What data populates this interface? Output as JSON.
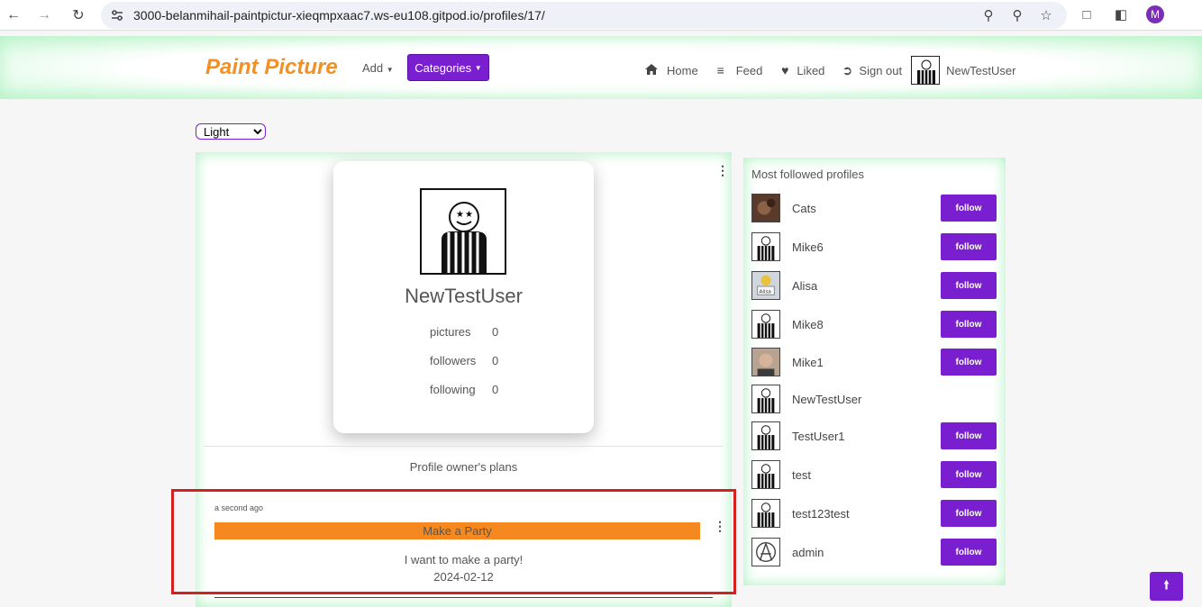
{
  "browser": {
    "url": "3000-belanmihail-paintpictur-xieqmpxaac7.ws-eu108.gitpod.io/profiles/17/",
    "profile_initial": "M"
  },
  "header": {
    "brand": "Paint Picture",
    "add_label": "Add",
    "categories_label": "Categories",
    "nav": [
      {
        "label": "Home",
        "icon": "home-icon"
      },
      {
        "label": "Feed",
        "icon": "list-icon"
      },
      {
        "label": "Liked",
        "icon": "heart-icon"
      },
      {
        "label": "Sign out",
        "icon": "sign-out-icon"
      }
    ],
    "username": "NewTestUser"
  },
  "theme": {
    "selected": "Light"
  },
  "profile": {
    "name": "NewTestUser",
    "stats": [
      {
        "label": "pictures",
        "value": "0"
      },
      {
        "label": "followers",
        "value": "0"
      },
      {
        "label": "following",
        "value": "0"
      }
    ],
    "plans_title": "Profile owner's plans"
  },
  "plan": {
    "time": "a second ago",
    "title": "Make a Party",
    "text": "I want to make a party!",
    "date": "2024-02-12"
  },
  "sidebar": {
    "title": "Most followed profiles",
    "follow_label": "follow",
    "profiles": [
      {
        "name": "Cats",
        "avatar": "cat",
        "followable": true
      },
      {
        "name": "Mike6",
        "avatar": "default",
        "followable": true
      },
      {
        "name": "Alisa",
        "avatar": "alisa",
        "followable": true
      },
      {
        "name": "Mike8",
        "avatar": "default",
        "followable": true
      },
      {
        "name": "Mike1",
        "avatar": "photo",
        "followable": true
      },
      {
        "name": "NewTestUser",
        "avatar": "default",
        "followable": false
      },
      {
        "name": "TestUser1",
        "avatar": "default",
        "followable": true
      },
      {
        "name": "test",
        "avatar": "default",
        "followable": true
      },
      {
        "name": "test123test",
        "avatar": "default",
        "followable": true
      },
      {
        "name": "admin",
        "avatar": "anarchy",
        "followable": true
      }
    ]
  },
  "colors": {
    "accent": "#7a1fcf",
    "brand": "#f39024",
    "plan_bar": "#f5891f",
    "highlight": "#d42020"
  }
}
